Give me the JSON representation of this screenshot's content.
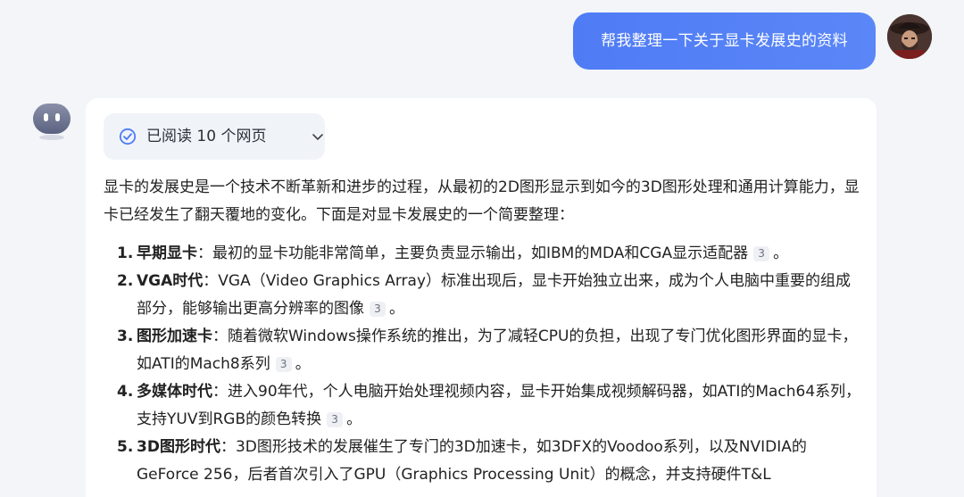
{
  "user_message": {
    "text": "帮我整理一下关于显卡发展史的资料"
  },
  "answer": {
    "sources_pill": {
      "label": "已阅读 10 个网页"
    },
    "intro": "显卡的发展史是一个技术不断革新和进步的过程，从最初的2D图形显示到如今的3D图形处理和通用计算能力，显卡已经发生了翻天覆地的变化。下面是对显卡发展史的一个简要整理：",
    "items": [
      {
        "num": "1.",
        "term": "早期显卡",
        "sep": "：",
        "text": "最初的显卡功能非常简单，主要负责显示输出，如IBM的MDA和CGA显示适配器",
        "cite": "3",
        "end": "。"
      },
      {
        "num": "2.",
        "term": "VGA时代",
        "sep": "：",
        "text": "VGA（Video Graphics Array）标准出现后，显卡开始独立出来，成为个人电脑中重要的组成部分，能够输出更高分辨率的图像",
        "cite": "3",
        "end": "。"
      },
      {
        "num": "3.",
        "term": "图形加速卡",
        "sep": "：",
        "text": "随着微软Windows操作系统的推出，为了减轻CPU的负担，出现了专门优化图形界面的显卡，如ATI的Mach8系列",
        "cite": "3",
        "end": "。"
      },
      {
        "num": "4.",
        "term": "多媒体时代",
        "sep": "：",
        "text": "进入90年代，个人电脑开始处理视频内容，显卡开始集成视频解码器，如ATI的Mach64系列，支持YUV到RGB的颜色转换",
        "cite": "3",
        "end": "。"
      },
      {
        "num": "5.",
        "term": "3D图形时代",
        "sep": "：",
        "text": "3D图形技术的发展催生了专门的3D加速卡，如3DFX的Voodoo系列，以及NVIDIA的GeForce 256，后者首次引入了GPU（Graphics Processing Unit）的概念，并支持硬件T&L",
        "cite": "",
        "end": ""
      }
    ]
  },
  "icons": {
    "user_avatar": "user-avatar-image",
    "bot_avatar": "bot-avatar-icon",
    "check": "check-circle-icon",
    "chevron": "chevron-down-icon"
  },
  "colors": {
    "page_bg": "#f3f5f8",
    "user_bubble": "#4f7cf5",
    "card_bg": "#ffffff",
    "pill_bg": "#f0f3f8",
    "accent": "#4f7cf5"
  }
}
